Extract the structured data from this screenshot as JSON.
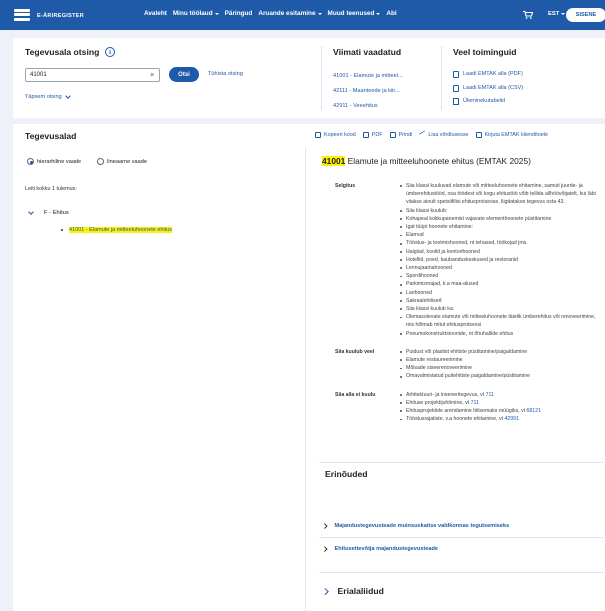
{
  "header": {
    "logo_text": "E-ÄRIREGISTER",
    "nav": [
      {
        "label": "Avaleht",
        "dropdown": false
      },
      {
        "label": "Minu töölaud",
        "dropdown": true
      },
      {
        "label": "Päringud",
        "dropdown": false
      },
      {
        "label": "Aruande esitamine",
        "dropdown": true
      },
      {
        "label": "Muud teenused",
        "dropdown": true
      },
      {
        "label": "Abi",
        "dropdown": false
      }
    ],
    "cart_icon": "cart-icon",
    "language": "EST",
    "login_label": "SISENE"
  },
  "search": {
    "title": "Tegevusala otsing",
    "info_icon": "i",
    "input_value": "41001",
    "clear_icon": "×",
    "search_button": "Otsi",
    "cancel_link": "Tühista otsing",
    "advanced_link": "Täpsem otsing"
  },
  "recent": {
    "title": "Viimati vaadatud",
    "items": [
      "41001 - Elamute ja mitteel...",
      "42111 - Maanteede ja kiir...",
      "42911 - Veeehitus"
    ]
  },
  "more_actions": {
    "title": "Veel toiminguid",
    "items": [
      "Laadi EMTAK alla (PDF)",
      "Laadi EMTAK alla (CSV)",
      "Üleminekutabelid"
    ]
  },
  "activities": {
    "title": "Tegevusalad",
    "toolbar": [
      "Kopeeri kood",
      "PDF",
      "Prindi",
      "Lisa võrdlusesse",
      "Kirjuta EMTAK klienditoele"
    ],
    "view_options": [
      "hierarhiline vaade",
      "lineaarne vaade"
    ],
    "selected_view": "hierarhiline vaade",
    "result_count": "Leiti kokku 1 tulemus:",
    "tree_parent": "F - Ehitus",
    "tree_child": "41001 - Elamute ja mitteeluhoonete ehitus"
  },
  "detail": {
    "code": "41001",
    "title": "Elamute ja mitteeluhoonete ehitus (EMTAK 2025)",
    "selgitus_label": "Selgitus",
    "selgitus": [
      "Siia klassi kuuluvad elamute või mitteeluhoonete ehitamine, samuti juurde- ja ümberehitustööd, osa töödest või kogu ehitustöö võib tellida allhöövõtjatelt, kui läbi viiakse ainult spetsiifilisi ehitusprotsesse, liigitatakse tegevus osta 43.",
      "Siia klassi kuulub:",
      "Kohapeal kokkupanemist vajavate elementhoonete püstitamine",
      "Igat tüüpi hoonete ehitamine:",
      "Elamud",
      "Tööstus- ja tootmishooned, nt tehased, töökojad jms.",
      "Haiglad, koolid ja kontorihooned",
      "Hotellid, poed, kaubanduskeskused ja restoranid",
      "Lennujaamahooned",
      "Spordihooned",
      "Parkimismajad, k.a maa-alused",
      "Laohooned",
      "Sakraalehitised",
      "Siia klassi kuulub ka:",
      "Olemasolevate elamute või mitteeluhoonete täielik ümberehitus või renoveerimine, mis hõlmab mitut ehitusprotsessi",
      "Pneumokonstruktsioonide, nt õhuhallide ehitus"
    ],
    "kuulub_label": "Siia kuulub veel",
    "kuulub": [
      "Puidust või plastist ehitiste püstitamine/paigaldamine",
      "Elamute restaureerimine",
      "Mõisade siseerenoveerimine",
      "Omavalmistatud puitehitiste paigaldamine/püstitamine"
    ],
    "ei_kuulu_label": "Siia alla ei kuulu",
    "ei_kuulu": [
      {
        "text": "Arhitektuuri- ja inseneritegevus, vt ",
        "ref": "711"
      },
      {
        "text": "Ehituse projektijuhtimine, vt ",
        "ref": "711"
      },
      {
        "text": "Ehitusprojektide arendamine hilisemaks müügiks, vt ",
        "ref": "68121"
      },
      {
        "text": "Tööstusrajatiste, v.a hoonete ehitamine, vt ",
        "ref": "42991"
      }
    ]
  },
  "requirements": {
    "title": "Erinõuded",
    "items": [
      "Majandustegevusteade muinsuskaitse valdkonnas tegutsemiseks",
      "Ehitusettevõtja majandustegevusteade"
    ]
  },
  "specializations": {
    "title": "Erialaliidud"
  },
  "colors": {
    "primary": "#1f5aa8",
    "highlight": "#fff200",
    "background": "#eef2f8"
  }
}
